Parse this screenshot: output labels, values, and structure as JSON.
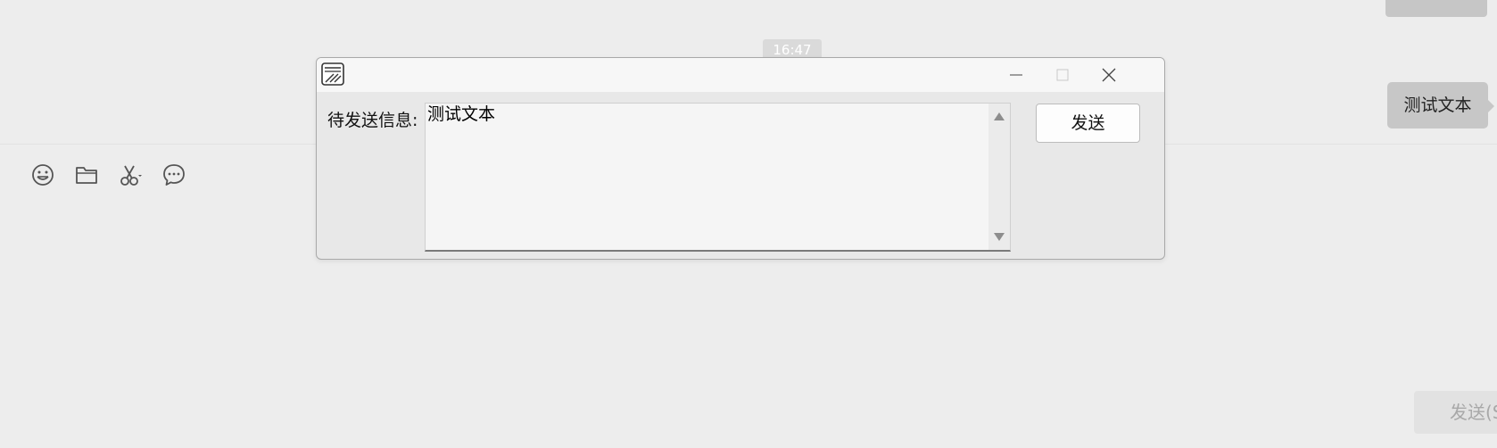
{
  "chat": {
    "timestamp": "16:47",
    "bubble_text": "测试文本"
  },
  "toolbar": {
    "icons": [
      "emoji-icon",
      "folder-icon",
      "scissors-icon",
      "chat-history-icon"
    ]
  },
  "bottom": {
    "send_label": "发送(S)"
  },
  "dialog": {
    "field_label": "待发送信息:",
    "message_text": "测试文本",
    "send_label": "发送"
  }
}
